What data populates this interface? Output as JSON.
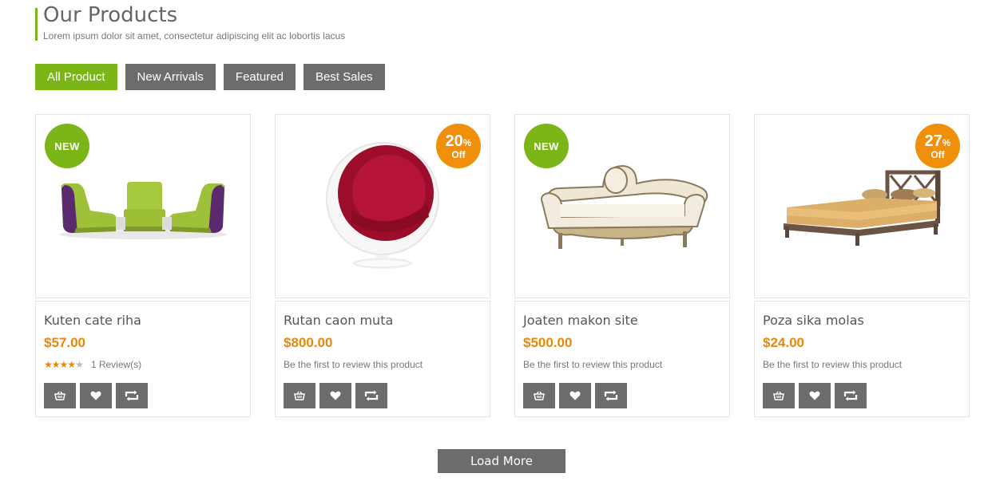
{
  "header": {
    "title": "Our Products",
    "subtitle": "Lorem ipsum dolor sit amet, consectetur adipiscing elit ac lobortis lacus"
  },
  "tabs": [
    {
      "label": "All Product",
      "active": true
    },
    {
      "label": "New Arrivals",
      "active": false
    },
    {
      "label": "Featured",
      "active": false
    },
    {
      "label": "Best Sales",
      "active": false
    }
  ],
  "products": [
    {
      "name": "Kuten cate riha",
      "price": "$57.00",
      "badge": "NEW",
      "rating_stars": 4,
      "review_text": "1 Review(s)",
      "image": "green-modular-chairs-image"
    },
    {
      "name": "Rutan caon muta",
      "price": "$800.00",
      "badge_percent": "20",
      "badge_percent_sign": "%",
      "badge_off": "Off",
      "review_text": "Be the first to review this product",
      "image": "red-ball-chair-image"
    },
    {
      "name": "Joaten makon site",
      "price": "$500.00",
      "badge": "NEW",
      "review_text": "Be the first to review this product",
      "image": "baroque-sofa-image"
    },
    {
      "name": "Poza sika molas",
      "price": "$24.00",
      "badge_percent": "27",
      "badge_percent_sign": "%",
      "badge_off": "Off",
      "review_text": "Be the first to review this product",
      "image": "wooden-bed-image"
    }
  ],
  "actions": [
    "basket-icon",
    "heart-icon",
    "compare-icon"
  ],
  "load_more_label": "Load More",
  "colors": {
    "accent": "#7cb518",
    "price": "#e8870a",
    "sale_badge": "#f0900a",
    "button_gray": "#6c6c6c"
  }
}
